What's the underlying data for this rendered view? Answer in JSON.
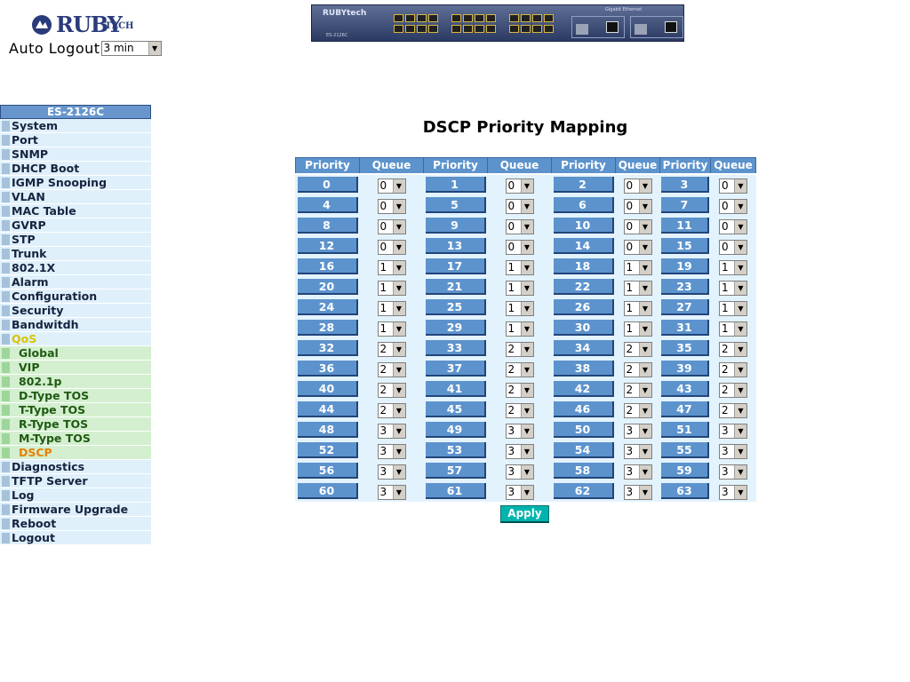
{
  "brand": {
    "logo_text": "RUBY",
    "logo_suffix": "TECH"
  },
  "auto_logout": {
    "label": "Auto Logout",
    "value": "3 min"
  },
  "switch_image": {
    "brand": "RUBYtech",
    "model": "ES-2126C",
    "uplink_label": "Gigabit Ethernet"
  },
  "sidebar": {
    "header": "ES-2126C",
    "items": [
      {
        "label": "System"
      },
      {
        "label": "Port"
      },
      {
        "label": "SNMP"
      },
      {
        "label": "DHCP Boot"
      },
      {
        "label": "IGMP Snooping"
      },
      {
        "label": "VLAN"
      },
      {
        "label": "MAC Table"
      },
      {
        "label": "GVRP"
      },
      {
        "label": "STP"
      },
      {
        "label": "Trunk"
      },
      {
        "label": "802.1X"
      },
      {
        "label": "Alarm"
      },
      {
        "label": "Configuration"
      },
      {
        "label": "Security"
      },
      {
        "label": "Bandwitdh"
      },
      {
        "label": "QoS",
        "active": true,
        "children": [
          {
            "label": "Global"
          },
          {
            "label": "VIP"
          },
          {
            "label": "802.1p"
          },
          {
            "label": "D-Type TOS"
          },
          {
            "label": "T-Type TOS"
          },
          {
            "label": "R-Type TOS"
          },
          {
            "label": "M-Type TOS"
          },
          {
            "label": "DSCP",
            "current": true
          }
        ]
      },
      {
        "label": "Diagnostics"
      },
      {
        "label": "TFTP Server"
      },
      {
        "label": "Log"
      },
      {
        "label": "Firmware Upgrade"
      },
      {
        "label": "Reboot"
      },
      {
        "label": "Logout"
      }
    ]
  },
  "main": {
    "title": "DSCP Priority Mapping",
    "headers": [
      "Priority",
      "Queue",
      "Priority",
      "Queue",
      "Priority",
      "Queue",
      "Priority",
      "Queue"
    ],
    "rows": [
      [
        {
          "p": "0",
          "q": "0"
        },
        {
          "p": "1",
          "q": "0"
        },
        {
          "p": "2",
          "q": "0"
        },
        {
          "p": "3",
          "q": "0"
        }
      ],
      [
        {
          "p": "4",
          "q": "0"
        },
        {
          "p": "5",
          "q": "0"
        },
        {
          "p": "6",
          "q": "0"
        },
        {
          "p": "7",
          "q": "0"
        }
      ],
      [
        {
          "p": "8",
          "q": "0"
        },
        {
          "p": "9",
          "q": "0"
        },
        {
          "p": "10",
          "q": "0"
        },
        {
          "p": "11",
          "q": "0"
        }
      ],
      [
        {
          "p": "12",
          "q": "0"
        },
        {
          "p": "13",
          "q": "0"
        },
        {
          "p": "14",
          "q": "0"
        },
        {
          "p": "15",
          "q": "0"
        }
      ],
      [
        {
          "p": "16",
          "q": "1"
        },
        {
          "p": "17",
          "q": "1"
        },
        {
          "p": "18",
          "q": "1"
        },
        {
          "p": "19",
          "q": "1"
        }
      ],
      [
        {
          "p": "20",
          "q": "1"
        },
        {
          "p": "21",
          "q": "1"
        },
        {
          "p": "22",
          "q": "1"
        },
        {
          "p": "23",
          "q": "1"
        }
      ],
      [
        {
          "p": "24",
          "q": "1"
        },
        {
          "p": "25",
          "q": "1"
        },
        {
          "p": "26",
          "q": "1"
        },
        {
          "p": "27",
          "q": "1"
        }
      ],
      [
        {
          "p": "28",
          "q": "1"
        },
        {
          "p": "29",
          "q": "1"
        },
        {
          "p": "30",
          "q": "1"
        },
        {
          "p": "31",
          "q": "1"
        }
      ],
      [
        {
          "p": "32",
          "q": "2"
        },
        {
          "p": "33",
          "q": "2"
        },
        {
          "p": "34",
          "q": "2"
        },
        {
          "p": "35",
          "q": "2"
        }
      ],
      [
        {
          "p": "36",
          "q": "2"
        },
        {
          "p": "37",
          "q": "2"
        },
        {
          "p": "38",
          "q": "2"
        },
        {
          "p": "39",
          "q": "2"
        }
      ],
      [
        {
          "p": "40",
          "q": "2"
        },
        {
          "p": "41",
          "q": "2"
        },
        {
          "p": "42",
          "q": "2"
        },
        {
          "p": "43",
          "q": "2"
        }
      ],
      [
        {
          "p": "44",
          "q": "2"
        },
        {
          "p": "45",
          "q": "2"
        },
        {
          "p": "46",
          "q": "2"
        },
        {
          "p": "47",
          "q": "2"
        }
      ],
      [
        {
          "p": "48",
          "q": "3"
        },
        {
          "p": "49",
          "q": "3"
        },
        {
          "p": "50",
          "q": "3"
        },
        {
          "p": "51",
          "q": "3"
        }
      ],
      [
        {
          "p": "52",
          "q": "3"
        },
        {
          "p": "53",
          "q": "3"
        },
        {
          "p": "54",
          "q": "3"
        },
        {
          "p": "55",
          "q": "3"
        }
      ],
      [
        {
          "p": "56",
          "q": "3"
        },
        {
          "p": "57",
          "q": "3"
        },
        {
          "p": "58",
          "q": "3"
        },
        {
          "p": "59",
          "q": "3"
        }
      ],
      [
        {
          "p": "60",
          "q": "3"
        },
        {
          "p": "61",
          "q": "3"
        },
        {
          "p": "62",
          "q": "3"
        },
        {
          "p": "63",
          "q": "3"
        }
      ]
    ],
    "apply_label": "Apply"
  },
  "colors": {
    "header_blue": "#5d93cd",
    "sidebar_bg": "#dff0fb",
    "submenu_bg": "#d3efcf",
    "active_menu": "#d9c400",
    "current_submenu": "#e88000",
    "apply_button": "#00b4ae"
  }
}
